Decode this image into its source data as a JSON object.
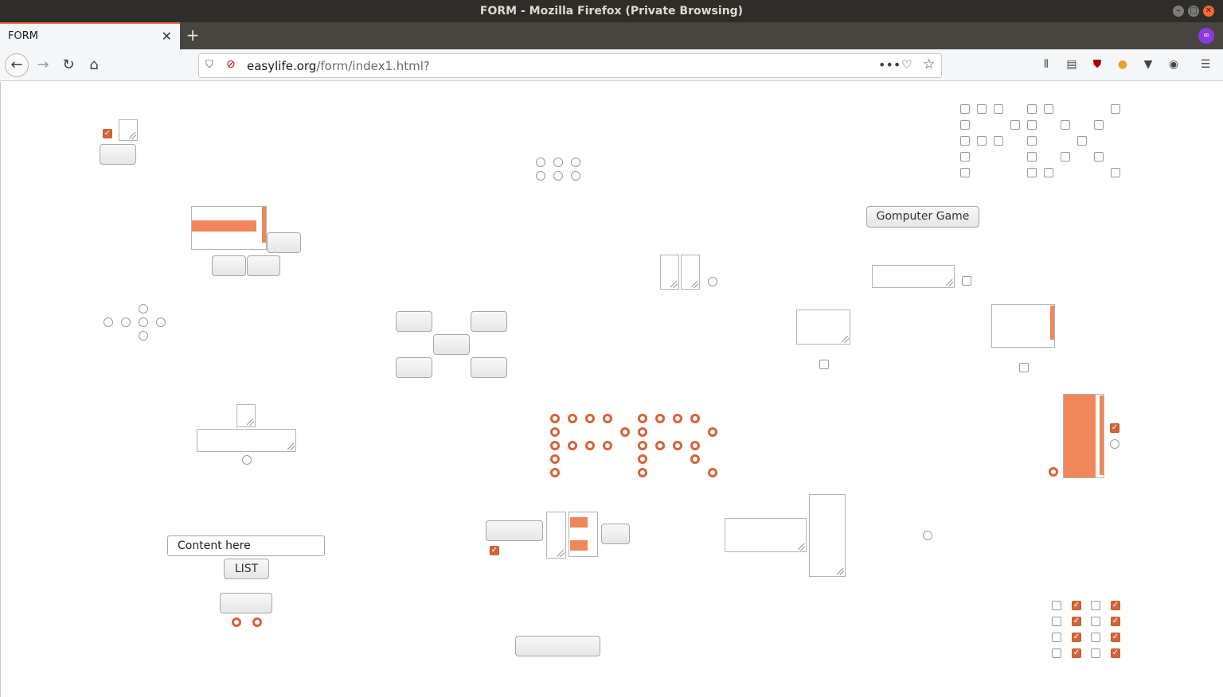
{
  "window": {
    "title": "FORM - Mozilla Firefox (Private Browsing)"
  },
  "tabs": [
    {
      "label": "FORM",
      "close": "✕"
    }
  ],
  "new_tab": "+",
  "private_icon": "∞",
  "address_bar": {
    "domain": "easylife.org",
    "path": "/form/index1.html?"
  },
  "page": {
    "text_input_value": "Content here",
    "list_button_label": "LIST",
    "game_button_label": "Gomputer Game"
  },
  "colors": {
    "accent": "#d4653a",
    "selection": "#f0875a",
    "titlebar": "#2e2d29"
  },
  "icons": [
    "back-arrow-icon",
    "forward-arrow-icon",
    "reload-icon",
    "home-icon",
    "shield-icon",
    "insecure-lock-icon",
    "more-actions-icon",
    "pocket-icon",
    "bookmark-star-icon",
    "library-icon",
    "sidebar-icon",
    "ublock-icon",
    "extension-icon",
    "vpn-icon",
    "account-icon",
    "hamburger-menu-icon"
  ]
}
